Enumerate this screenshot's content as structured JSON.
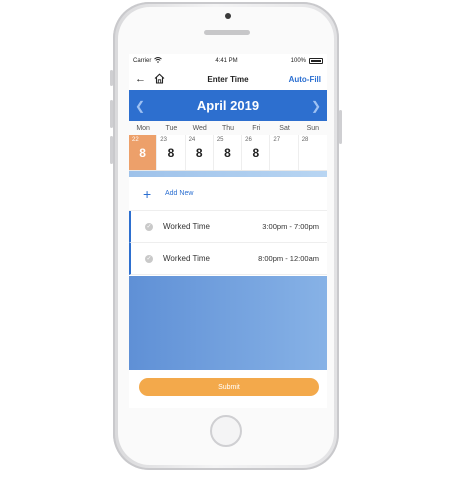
{
  "status_bar": {
    "carrier": "Carrier",
    "time": "4:41 PM",
    "battery": "100%"
  },
  "nav": {
    "title": "Enter Time",
    "auto_fill": "Auto-Fill"
  },
  "calendar": {
    "month": "April 2019",
    "weekdays": [
      "Mon",
      "Tue",
      "Wed",
      "Thu",
      "Fri",
      "Sat",
      "Sun"
    ],
    "days": [
      {
        "date": "22",
        "hours": "8",
        "selected": true
      },
      {
        "date": "23",
        "hours": "8"
      },
      {
        "date": "24",
        "hours": "8"
      },
      {
        "date": "25",
        "hours": "8"
      },
      {
        "date": "26",
        "hours": "8"
      },
      {
        "date": "27",
        "hours": ""
      },
      {
        "date": "28",
        "hours": ""
      }
    ]
  },
  "add_new": {
    "label": "Add New"
  },
  "entries": [
    {
      "label": "Worked Time",
      "time": "3:00pm - 7:00pm"
    },
    {
      "label": "Worked Time",
      "time": "8:00pm - 12:00am"
    }
  ],
  "submit": {
    "label": "Submit"
  },
  "colors": {
    "primary_blue": "#2d6fcf",
    "selected_day": "#eda06a",
    "submit_orange": "#f3a94b"
  }
}
